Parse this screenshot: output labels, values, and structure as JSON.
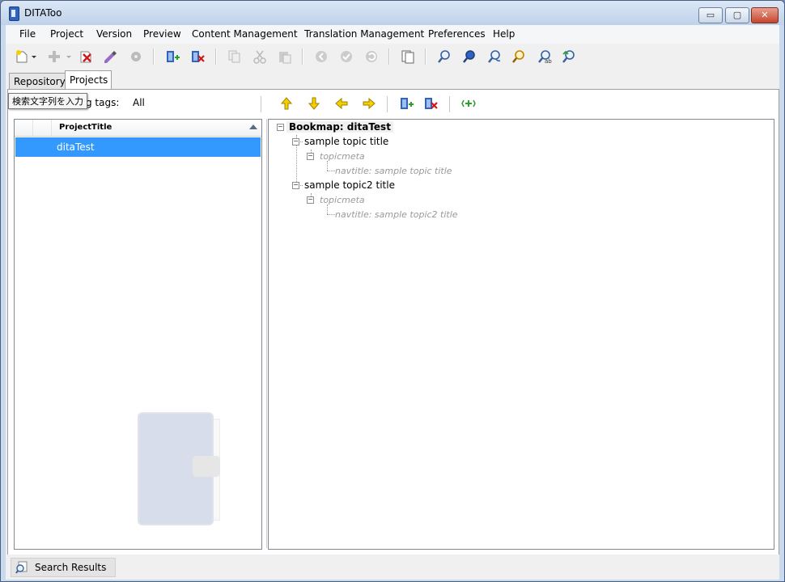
{
  "window": {
    "title": "DITAToo",
    "minimize_label": "▭",
    "maximize_label": "▢",
    "close_label": "✕"
  },
  "menu": [
    "File",
    "Project",
    "Version",
    "Preview",
    "Content Management",
    "Translation Management",
    "Preferences",
    "Help"
  ],
  "tabs": [
    {
      "label": "Repository",
      "active": false
    },
    {
      "label": "Projects",
      "active": true
    }
  ],
  "filter": {
    "tooltip": "検索文字列を入力",
    "label": "g tags:",
    "value": "All"
  },
  "projects": {
    "column_title": "ProjectTitle",
    "rows": [
      "ditaTest"
    ],
    "selected_index": 0
  },
  "tree": {
    "root": "Bookmap: ditaTest",
    "topics": [
      {
        "title": "sample topic title",
        "meta": "topicmeta",
        "navtitle": "navtitle: sample topic title"
      },
      {
        "title": "sample topic2 title",
        "meta": "topicmeta",
        "navtitle": "navtitle: sample topic2 title"
      }
    ]
  },
  "status": {
    "results_label": "Search Results"
  },
  "colors": {
    "selection": "#3399ff",
    "titlebar": "#c9d9ee",
    "accent_yellow": "#f5d000",
    "accent_green": "#2aa02a",
    "accent_red": "#d01818"
  }
}
